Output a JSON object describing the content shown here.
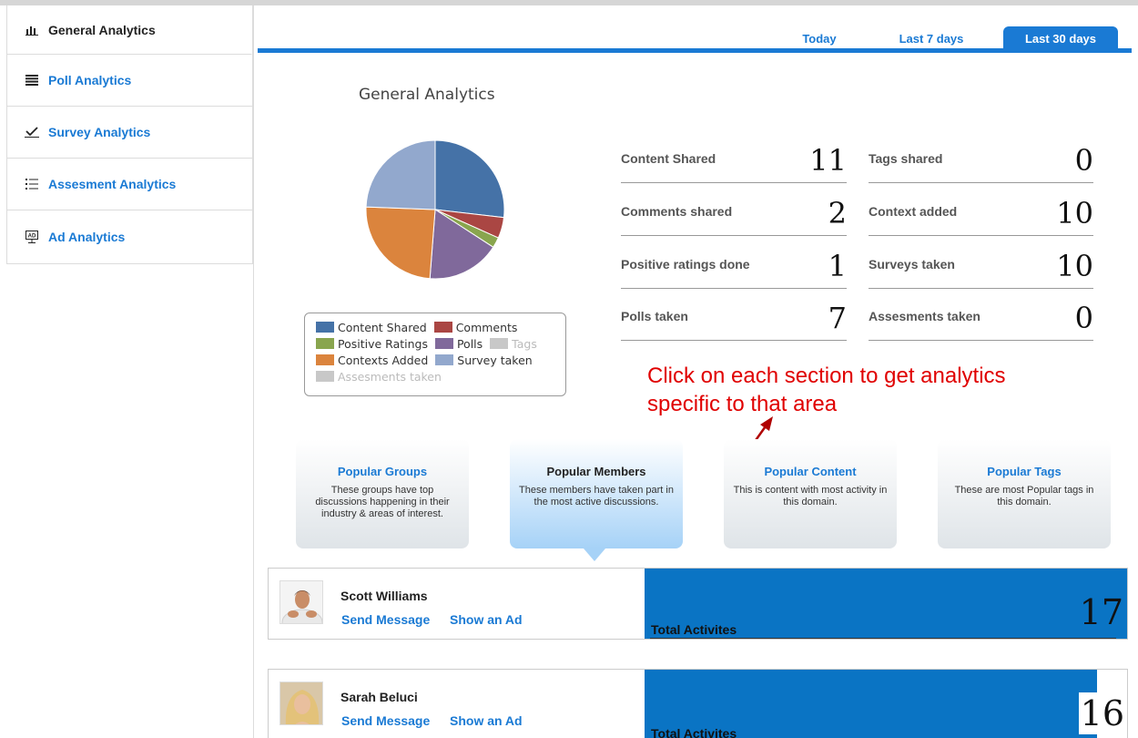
{
  "sidebar": {
    "items": [
      {
        "label": "General Analytics",
        "icon": "bar-chart-icon",
        "active": true
      },
      {
        "label": "Poll Analytics",
        "icon": "list-bars-icon"
      },
      {
        "label": "Survey Analytics",
        "icon": "checkmark-icon"
      },
      {
        "label": "Assesment Analytics",
        "icon": "bullet-list-icon"
      },
      {
        "label": "Ad Analytics",
        "icon": "ad-board-icon"
      }
    ]
  },
  "tabs": {
    "today": "Today",
    "seven": "Last 7 days",
    "thirty": "Last 30 days",
    "active": "Last 30 days"
  },
  "main": {
    "title": "General Analytics"
  },
  "chart_data": {
    "type": "pie",
    "values": [
      {
        "label": "Content Shared",
        "value": 11,
        "color": "#4572a7"
      },
      {
        "label": "Comments",
        "value": 2,
        "color": "#aa4643"
      },
      {
        "label": "Positive Ratings",
        "value": 1,
        "color": "#89a54e"
      },
      {
        "label": "Polls",
        "value": 7,
        "color": "#80699b"
      },
      {
        "label": "Tags",
        "value": 0,
        "color": "#c0c0c0"
      },
      {
        "label": "Contexts Added",
        "value": 10,
        "color": "#db843d"
      },
      {
        "label": "Survey taken",
        "value": 10,
        "color": "#92a8cd"
      },
      {
        "label": "Assesments taken",
        "value": 0,
        "color": "#c0c0c0"
      }
    ]
  },
  "legend": {
    "content_shared": "Content Shared",
    "comments": "Comments",
    "positive_ratings": "Positive Ratings",
    "polls": "Polls",
    "tags": "Tags",
    "contexts_added": "Contexts Added",
    "survey_taken": "Survey taken",
    "assesments_taken": "Assesments taken"
  },
  "stats": {
    "content_shared": {
      "label": "Content Shared",
      "value": "11"
    },
    "comments_shared": {
      "label": "Comments shared",
      "value": "2"
    },
    "positive_ratings": {
      "label": "Positive ratings done",
      "value": "1"
    },
    "polls_taken": {
      "label": "Polls taken",
      "value": "7"
    },
    "tags_shared": {
      "label": "Tags shared",
      "value": "0"
    },
    "context_added": {
      "label": "Context added",
      "value": "10"
    },
    "surveys_taken": {
      "label": "Surveys taken",
      "value": "10"
    },
    "assesments_taken": {
      "label": "Assesments taken",
      "value": "0"
    }
  },
  "annotation": {
    "line1": "Click on each section to get analytics",
    "line2": "specific to that area"
  },
  "cards": [
    {
      "title": "Popular Groups",
      "desc": "These groups have top discussions happening in their industry & areas of interest."
    },
    {
      "title": "Popular Members",
      "desc": "These members have taken part in the most active discussions.",
      "active": true
    },
    {
      "title": "Popular Content",
      "desc": "This is content with most activity in this domain."
    },
    {
      "title": "Popular Tags",
      "desc": "These are most Popular tags in this domain."
    }
  ],
  "members": [
    {
      "name": "Scott Williams",
      "send_message": "Send Message",
      "show_ad": "Show an Ad",
      "total_label": "Total Activites",
      "total": "17"
    },
    {
      "name": "Sarah Beluci",
      "send_message": "Send Message",
      "show_ad": "Show an Ad",
      "total_label": "Total Activites",
      "total": "16"
    }
  ]
}
